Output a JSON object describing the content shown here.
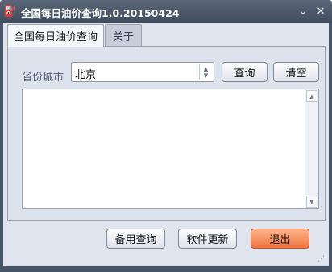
{
  "window": {
    "title": "全国每日油价查询1.0.20150424",
    "minimize_glyph": "⌄",
    "close_glyph": "✕",
    "icons": {
      "app": "fuel-app-icon",
      "minimize": "minimize-icon",
      "close": "close-icon"
    }
  },
  "tabs": [
    {
      "label": "全国每日油价查询",
      "active": true
    },
    {
      "label": "关于",
      "active": false
    }
  ],
  "query_panel": {
    "province_label": "省份城市",
    "province_value": "北京",
    "query_button": "查询",
    "clear_button": "清空"
  },
  "output": {
    "text": ""
  },
  "footer": {
    "backup_button": "备用查询",
    "update_button": "软件更新",
    "exit_button": "退出"
  },
  "colors": {
    "window_frame": "#485467",
    "client_background": "#dfe4ed",
    "exit_button": "#f07b45"
  }
}
